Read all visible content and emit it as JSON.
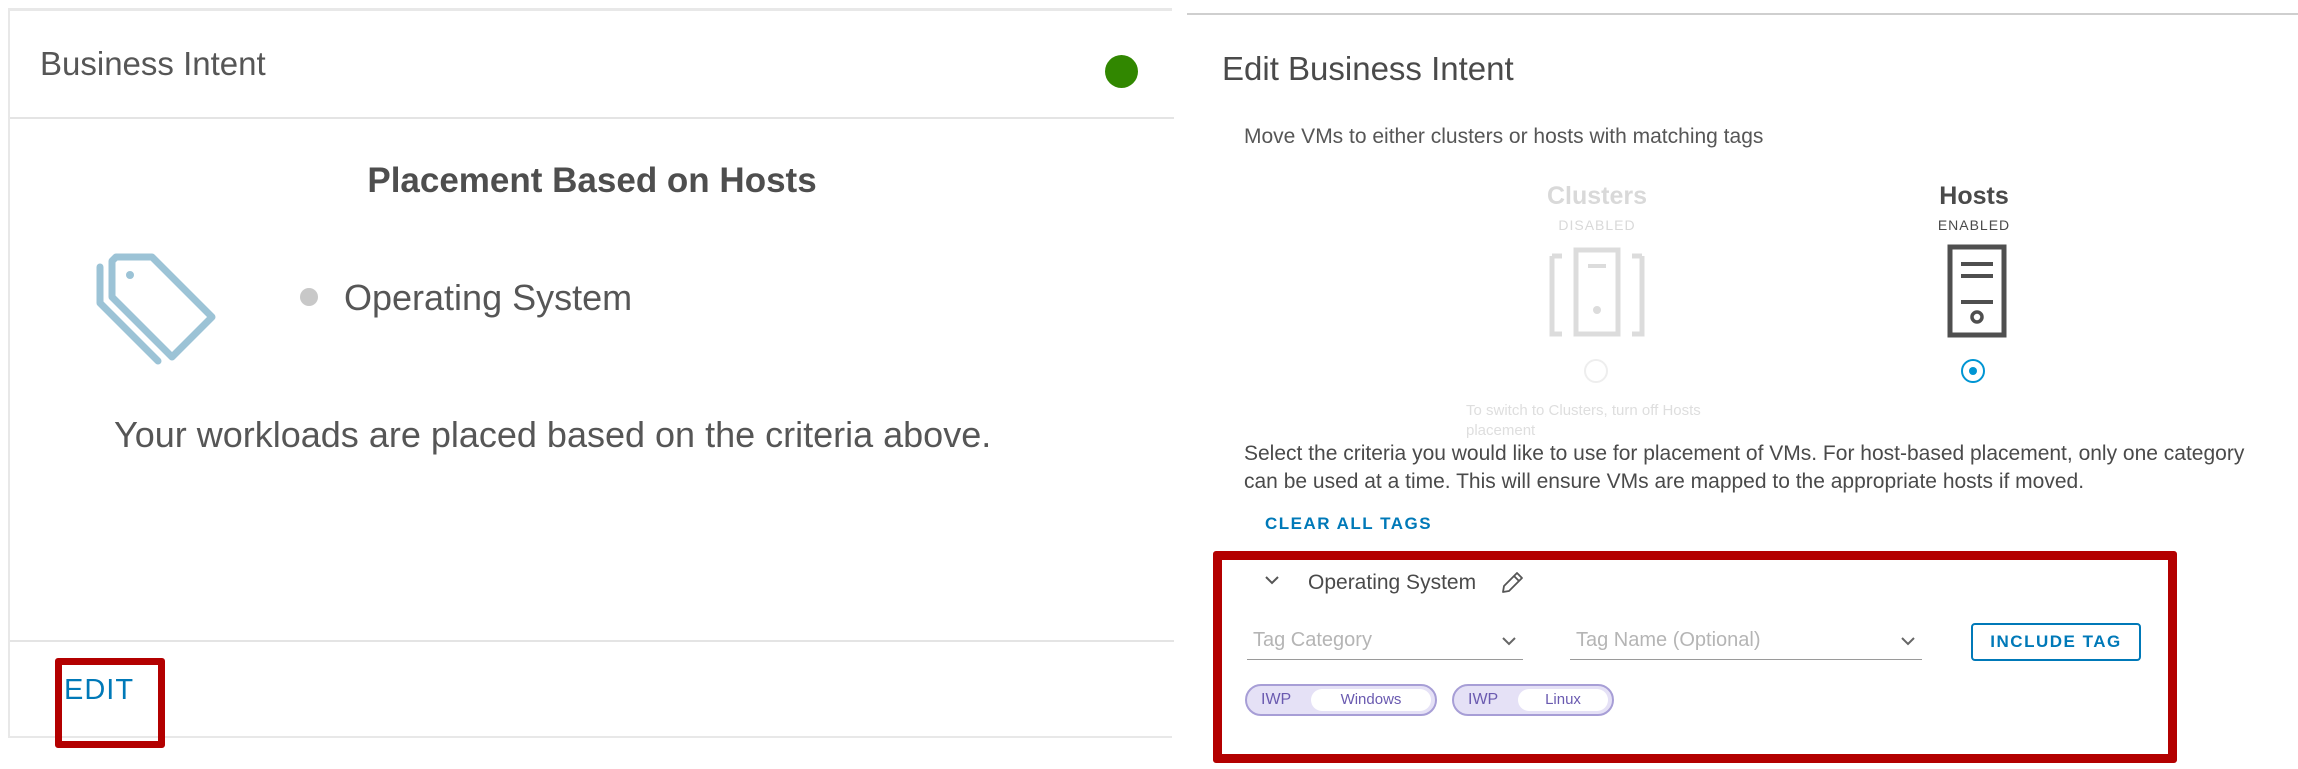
{
  "left_card": {
    "title": "Business Intent",
    "status_color": "#318700",
    "placement_title": "Placement Based on Hosts",
    "tag_icon": "tag-icon",
    "criteria": [
      "Operating System"
    ],
    "description": "Your workloads are placed based on the criteria above.",
    "edit_label": "EDIT"
  },
  "right_panel": {
    "title": "Edit Business Intent",
    "subtitle": "Move VMs to either clusters or hosts with matching tags",
    "options": {
      "clusters": {
        "label": "Clusters",
        "status": "DISABLED",
        "icon": "cluster-icon",
        "selected": false
      },
      "hosts": {
        "label": "Hosts",
        "status": "ENABLED",
        "icon": "server-icon",
        "selected": true
      }
    },
    "switch_hint": "To switch to Clusters, turn off Hosts placement",
    "criteria_text": "Select the criteria you would like to use for placement of VMs. For host-based placement, only one category can be used at a time. This will ensure VMs are mapped to the appropriate hosts if moved.",
    "clear_tags_label": "CLEAR ALL TAGS",
    "group": {
      "label": "Operating System",
      "tag_category_placeholder": "Tag Category",
      "tag_name_placeholder": "Tag Name (Optional)",
      "include_tag_label": "INCLUDE TAG",
      "tags": [
        {
          "category": "IWP",
          "name": "Windows"
        },
        {
          "category": "IWP",
          "name": "Linux"
        }
      ]
    }
  },
  "colors": {
    "accent": "#0079b8",
    "radio_selected": "#0095d3",
    "highlight": "#b30000",
    "tag_chip": "#e5e1f6"
  }
}
